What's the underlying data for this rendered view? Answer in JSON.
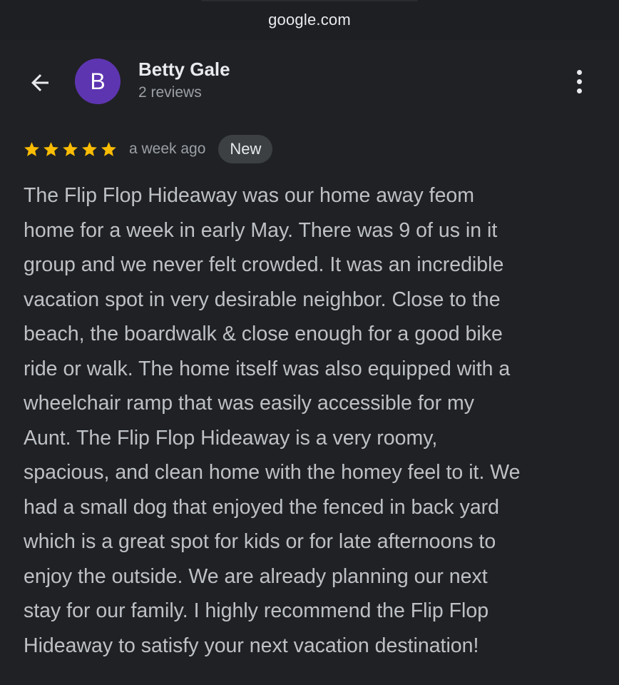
{
  "browser": {
    "url": "google.com"
  },
  "header": {
    "avatar_letter": "B",
    "author_name": "Betty Gale",
    "author_meta": "2 reviews"
  },
  "review": {
    "rating": 5,
    "rating_max": 5,
    "time_ago": "a week ago",
    "badge": "New",
    "text": "The Flip Flop Hideaway was our home away feom\nhome for a week in early May. There was 9 of us in it\ngroup and we never felt crowded. It was an incredible\nvacation spot in very desirable neighbor. Close to the\nbeach, the boardwalk & close enough for a good bike\nride or walk. The home itself was also equipped with a\nwheelchair ramp that was easily accessible for my\nAunt. The Flip Flop Hideaway is a very roomy,\nspacious, and clean home with the homey feel to it. We\nhad a small dog that enjoyed the fenced in back yard\nwhich is a great spot for kids or for late afternoons to\nenjoy the outside. We are already planning our next\nstay for our family. I highly recommend the Flip Flop\nHideaway to satisfy your next vacation destination!"
  },
  "icons": {
    "back": "arrow-left-icon",
    "more": "more-vertical-icon",
    "star": "star-icon"
  },
  "colors": {
    "background": "#202124",
    "avatar": "#5e35b1",
    "star": "#fbbc04",
    "badge_bg": "#3c4043"
  }
}
